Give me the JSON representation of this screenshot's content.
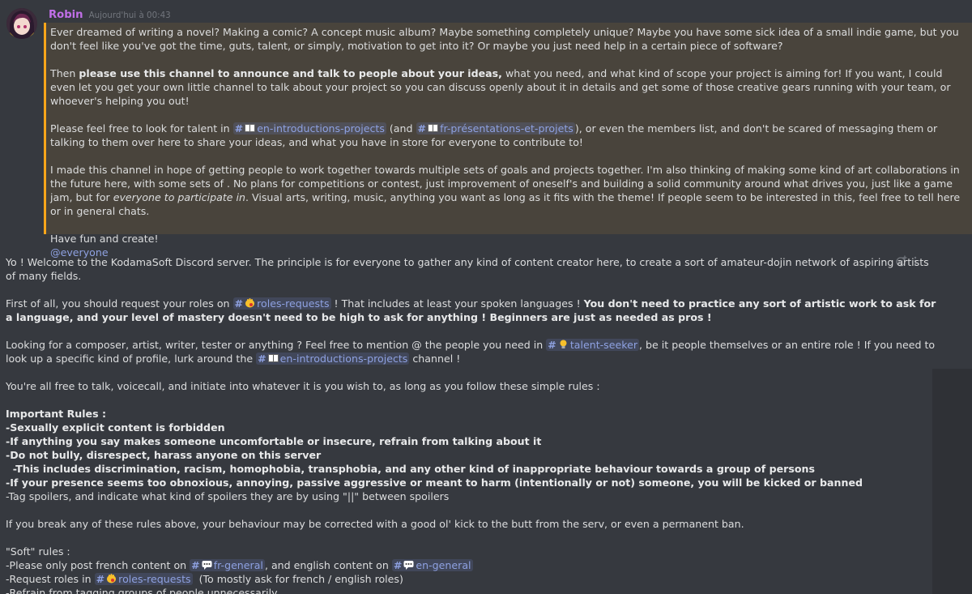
{
  "colors": {
    "background": "#36393f",
    "author": "#c16fe8",
    "mention_highlight": "#49443c",
    "mention_bar": "#faa61a",
    "channel_link": "#8ea1e1"
  },
  "message1": {
    "author": "Robin",
    "timestamp": "Aujourd'hui à 00:43",
    "p1": "Ever dreamed of writing a novel? Making a comic? A concept music album? Maybe something completely unique? Maybe you have some sick idea of a small indie game, but you don't feel like you've got the  time, guts, talent, or simply, motivation to get into it? Or maybe you just need help in a certain piece of software?",
    "p2_pre": "Then ",
    "p2_bold": "please use this channel to announce and talk to people about your ideas,",
    "p2_post": " what you need, and what kind of scope your project is aiming for! If you want, I could even let you get your own little channel to talk about your project so you can discuss openly about it in details and get some of those creative gears running with your team, or whoever's helping you out!",
    "p3_a": "Please feel free to look for talent in ",
    "p3_b": " (and ",
    "p3_c": "), or even the members list, and don't be scared of messaging them or talking to them over here to share your ideas, and what you have in store for everyone to contribute to!",
    "p4_a": "I made this channel in hope of getting people to work together towards multiple sets of goals and projects together. I'm also thinking of making some kind of art collaborations in the future here, with some sets of . No plans for competitions or contest, just improvement of oneself's and building a solid community around what drives you, just like a game jam, but for ",
    "p4_italic": "everyone to participate in",
    "p4_b": ". Visual arts, writing, music, anything you want as long as it fits with the theme! If people seem to be interested in this, feel free to tell here or in general chats.",
    "p5": "Have fun and create!",
    "mention": "@everyone"
  },
  "channels": {
    "hash": "#",
    "en_intro": "en-introductions-projects",
    "fr_pres": "fr-présentations-et-projets",
    "roles": "roles-requests",
    "talent": "talent-seeker",
    "fr_general": "fr-general",
    "en_general": "en-general"
  },
  "message2": {
    "p1": "Yo ! Welcome to the KodamaSoft Discord server. The principle is for everyone to gather any kind of content creator here, to create a sort of amateur-dojin network of aspiring artists of many fields.",
    "p2_a": "First of all, you should request your roles on ",
    "p2_b": " ! That includes at least your spoken languages ! ",
    "p2_bold": "You don't need to practice any sort of artistic work to ask for a language, and your level of mastery doesn't need to be high to ask for anything ! Beginners are just as needed as pros !",
    "p3_a": "Looking for a composer, artist, writer, tester or anything ? Feel free to mention @ the people you need in ",
    "p3_b": ", be it people themselves or an entire role ! If you need to look up a specific kind of profile, lurk around the ",
    "p3_c": " channel !",
    "p4": "You're all free to talk, voicecall, and initiate into whatever it is you wish to, as long as you follow these simple rules :",
    "rules_title": "Important Rules :",
    "rule1": "-Sexually explicit content is forbidden",
    "rule2": "-If anything you say makes someone uncomfortable or insecure, refrain from talking about it",
    "rule3": "-Do not bully, disrespect, harass anyone on this server",
    "rule3b": "  -This includes discrimination, racism, homophobia, transphobia, and any other kind of inappropriate behaviour towards a group of persons",
    "rule4": "-If your presence seems too obnoxious, annoying, passive aggressive or meant to harm (intentionally or not) someone, you will be kicked or banned",
    "rule5": "-Tag spoilers, and indicate what kind of spoilers they are by using \"||\" between spoilers",
    "p5": "If you break any of these rules above, your behaviour may be corrected with a good ol' kick to the butt from the serv, or even a permanent ban.",
    "soft_title": "\"Soft\" rules :",
    "soft1_a": "-Please only post french content on ",
    "soft1_b": ", and english content on ",
    "soft2_a": "-Request roles in ",
    "soft2_b": "  (To mostly ask for french / english roles)",
    "soft3": "-Refrain from tagging groups of people unnecessarily"
  },
  "icons": {
    "avatar": "avatar",
    "book": "book-icon",
    "speech": "speech-bubble-icon",
    "hand": "hand-icon",
    "bulb": "lightbulb-icon",
    "reaction": "add-reaction-icon",
    "more": "more-options-icon"
  }
}
